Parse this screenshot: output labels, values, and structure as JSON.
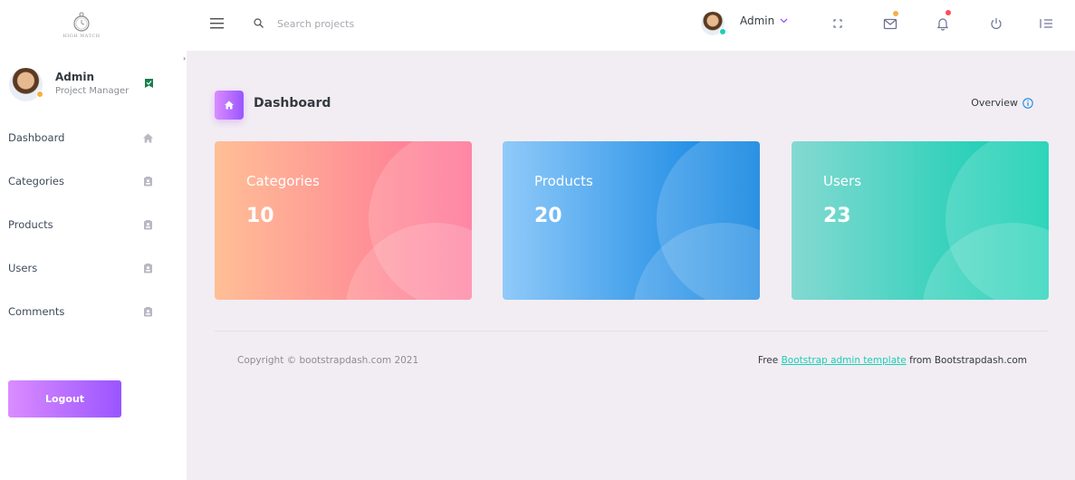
{
  "brand": {
    "logo_text": "HIGH WATCH"
  },
  "sidebar": {
    "profile": {
      "name": "Admin",
      "role": "Project Manager"
    },
    "items": [
      {
        "label": "Dashboard",
        "icon": "home-icon"
      },
      {
        "label": "Categories",
        "icon": "contact-card-icon"
      },
      {
        "label": "Products",
        "icon": "contact-card-icon"
      },
      {
        "label": "Users",
        "icon": "contact-card-icon"
      },
      {
        "label": "Comments",
        "icon": "contact-card-icon"
      }
    ],
    "logout_label": "Logout"
  },
  "topbar": {
    "search_placeholder": "Search projects",
    "user_name": "Admin",
    "icons": [
      "menu-icon",
      "search-icon",
      "fullscreen-icon",
      "mail-icon",
      "bell-icon",
      "power-icon",
      "list-icon"
    ]
  },
  "page": {
    "title": "Dashboard",
    "overview_label": "Overview"
  },
  "cards": [
    {
      "label": "Categories",
      "value": "10"
    },
    {
      "label": "Products",
      "value": "20"
    },
    {
      "label": "Users",
      "value": "23"
    }
  ],
  "footer": {
    "copyright": "Copyright © bootstrapdash.com 2021",
    "free_prefix": "Free",
    "link_text": "Bootstrap admin template",
    "suffix": "from Bootstrapdash.com"
  },
  "colors": {
    "accent": "#9a55ff",
    "accent_light": "#da8cff",
    "mail_badge": "#f5b041",
    "bell_badge": "#fe4d5c",
    "online": "#1bcfb4",
    "card_danger": [
      "#ffbf96",
      "#fe7096"
    ],
    "card_info": [
      "#90caf9",
      "#047edf"
    ],
    "card_success": [
      "#84d9d2",
      "#07cdae"
    ]
  }
}
